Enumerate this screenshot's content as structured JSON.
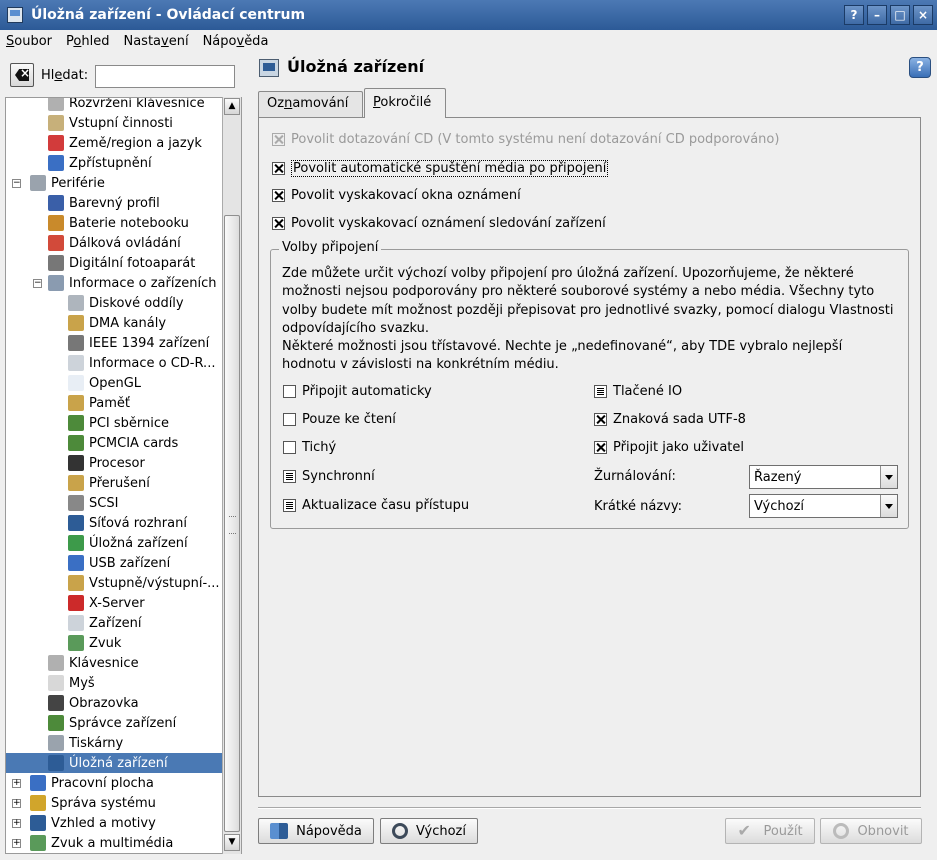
{
  "window": {
    "title": "Úložná zařízení - Ovládací centrum",
    "buttons": [
      "?",
      "–",
      "□",
      "×"
    ]
  },
  "menu": [
    {
      "label": "Soubor",
      "accel": "S",
      "pre": "",
      "post": "oubor"
    },
    {
      "label": "Pohled",
      "accel": "o",
      "pre": "P",
      "post": "hled"
    },
    {
      "label": "Nastavení",
      "accel": "v",
      "pre": "Nasta",
      "post": "ení"
    },
    {
      "label": "Nápověda",
      "accel": "v",
      "pre": "Nápo",
      "post": "ěda"
    }
  ],
  "search": {
    "label_pre": "Hl",
    "label_accel": "e",
    "label_post": "dat:",
    "value": ""
  },
  "tree": [
    {
      "label": "Rozvržení klávesnice",
      "level": 1,
      "icon": "keyboard-icon",
      "color": "#b0b0b0"
    },
    {
      "label": "Vstupní činnosti",
      "level": 1,
      "icon": "keyboard-icon",
      "color": "#c7b07a"
    },
    {
      "label": "Země/region a jazyk",
      "level": 1,
      "icon": "flag-icon",
      "color": "#d23b3b"
    },
    {
      "label": "Zpřístupnění",
      "level": 1,
      "icon": "accessibility-icon",
      "color": "#3a6fc4"
    },
    {
      "label": "Periférie",
      "level": 0,
      "icon": "mouse-icon",
      "color": "#9aa3ad",
      "expander": "−"
    },
    {
      "label": "Barevný profil",
      "level": 1,
      "icon": "color-profile-icon",
      "color": "#3a5fa8"
    },
    {
      "label": "Baterie notebooku",
      "level": 1,
      "icon": "battery-icon",
      "color": "#c98a2b"
    },
    {
      "label": "Dálková ovládání",
      "level": 1,
      "icon": "remote-icon",
      "color": "#d24a3a"
    },
    {
      "label": "Digitální fotoaparát",
      "level": 1,
      "icon": "camera-icon",
      "color": "#777"
    },
    {
      "label": "Informace o zařízeních",
      "level": 1,
      "icon": "info-icon",
      "color": "#8a9bb0",
      "expander": "−"
    },
    {
      "label": "Diskové oddíly",
      "level": 2,
      "icon": "disk-icon",
      "color": "#aeb5bd"
    },
    {
      "label": "DMA kanály",
      "level": 2,
      "icon": "dma-icon",
      "color": "#c9a34a"
    },
    {
      "label": "IEEE 1394 zařízení",
      "level": 2,
      "icon": "firewire-icon",
      "color": "#777"
    },
    {
      "label": "Informace o CD-R...",
      "level": 2,
      "icon": "cdrom-icon",
      "color": "#cdd3da"
    },
    {
      "label": "OpenGL",
      "level": 2,
      "icon": "opengl-icon",
      "color": "#e8eef5"
    },
    {
      "label": "Paměť",
      "level": 2,
      "icon": "memory-icon",
      "color": "#c9a34a"
    },
    {
      "label": "PCI sběrnice",
      "level": 2,
      "icon": "pci-icon",
      "color": "#4d8a3a"
    },
    {
      "label": "PCMCIA cards",
      "level": 2,
      "icon": "pcmcia-icon",
      "color": "#4d8a3a"
    },
    {
      "label": "Procesor",
      "level": 2,
      "icon": "cpu-icon",
      "color": "#333"
    },
    {
      "label": "Přerušení",
      "level": 2,
      "icon": "interrupt-icon",
      "color": "#c9a34a"
    },
    {
      "label": "SCSI",
      "level": 2,
      "icon": "scsi-icon",
      "color": "#888"
    },
    {
      "label": "Síťová rozhraní",
      "level": 2,
      "icon": "network-icon",
      "color": "#2d5c96"
    },
    {
      "label": "Úložná zařízení",
      "level": 2,
      "icon": "storage-icon",
      "color": "#3d9a4a"
    },
    {
      "label": "USB zařízení",
      "level": 2,
      "icon": "usb-icon",
      "color": "#3a6fc4"
    },
    {
      "label": "Vstupně/výstupní-...",
      "level": 2,
      "icon": "io-icon",
      "color": "#c9a34a"
    },
    {
      "label": "X-Server",
      "level": 2,
      "icon": "x-server-icon",
      "color": "#cc2a2a"
    },
    {
      "label": "Zařízení",
      "level": 2,
      "icon": "device-icon",
      "color": "#cdd3da"
    },
    {
      "label": "Zvuk",
      "level": 2,
      "icon": "sound-icon",
      "color": "#5a9a5a"
    },
    {
      "label": "Klávesnice",
      "level": 1,
      "icon": "keyboard-icon",
      "color": "#b0b0b0"
    },
    {
      "label": "Myš",
      "level": 1,
      "icon": "mouse-icon",
      "color": "#d8d8d8"
    },
    {
      "label": "Obrazovka",
      "level": 1,
      "icon": "display-icon",
      "color": "#444"
    },
    {
      "label": "Správce zařízení",
      "level": 1,
      "icon": "device-manager-icon",
      "color": "#4d8a3a"
    },
    {
      "label": "Tiskárny",
      "level": 1,
      "icon": "printer-icon",
      "color": "#9aa3ad"
    },
    {
      "label": "Úložná zařízení",
      "level": 1,
      "icon": "storage-icon",
      "color": "#2d5c96",
      "selected": true
    },
    {
      "label": "Pracovní plocha",
      "level": 0,
      "icon": "desktop-icon",
      "color": "#3a6fc4",
      "expander": "+"
    },
    {
      "label": "Správa systému",
      "level": 0,
      "icon": "system-icon",
      "color": "#d1a52b",
      "expander": "+"
    },
    {
      "label": "Vzhled a motivy",
      "level": 0,
      "icon": "appearance-icon",
      "color": "#2d5c96",
      "expander": "+"
    },
    {
      "label": "Zvuk a multimédia",
      "level": 0,
      "icon": "multimedia-icon",
      "color": "#5a9a5a",
      "expander": "+"
    }
  ],
  "module": {
    "title": "Úložná zařízení"
  },
  "tabs": [
    {
      "label": "Oznamování",
      "pre": "Oz",
      "accel": "n",
      "post": "amování"
    },
    {
      "label": "Pokročilé",
      "pre": "",
      "accel": "P",
      "post": "okročilé"
    }
  ],
  "checkboxes": [
    {
      "label": "Povolit dotazování CD (V tomto systému není dotazování CD podporováno)",
      "state": "checked",
      "disabled": true
    },
    {
      "label": "Povolit automatické spuštění média po připojení",
      "state": "checked",
      "focused": true
    },
    {
      "label": "Povolit vyskakovací okna oznámení",
      "state": "checked"
    },
    {
      "label": "Povolit vyskakovací oznámení sledování zařízení",
      "state": "checked"
    }
  ],
  "group": {
    "title": "Volby připojení",
    "description": "Zde můžete určit výchozí volby připojení pro úložná zařízení. Upozorňujeme, že některé možnosti nejsou podporovány pro některé souborové systémy a nebo média. Všechny tyto volby budete mít možnost později přepisovat pro jednotlivé svazky, pomocí dialogu Vlastnosti odpovídajícího svazku.",
    "description2": "Některé možnosti jsou třístavové. Nechte je „nedefinované“, aby TDE vybralo nejlepší hodnotu v závislosti na konkrétním médiu.",
    "left_options": [
      {
        "label": "Připojit automaticky",
        "state": "unchecked"
      },
      {
        "label": "Pouze ke čtení",
        "state": "unchecked"
      },
      {
        "label": "Tichý",
        "state": "unchecked"
      },
      {
        "label": "Synchronní",
        "state": "tristate"
      },
      {
        "label": "Aktualizace času přístupu",
        "state": "tristate"
      }
    ],
    "right_options": [
      {
        "label": "Tlačené IO",
        "state": "tristate"
      },
      {
        "label": "Znaková sada UTF-8",
        "state": "checked"
      },
      {
        "label": "Připojit jako uživatel",
        "state": "checked"
      }
    ],
    "journaling": {
      "label": "Žurnálování:",
      "value": "Řazený"
    },
    "short_names": {
      "label": "Krátké názvy:",
      "value": "Výchozí"
    }
  },
  "buttons": {
    "help": "Nápověda",
    "defaults": "Výchozí",
    "apply": "Použít",
    "reset": "Obnovit"
  }
}
